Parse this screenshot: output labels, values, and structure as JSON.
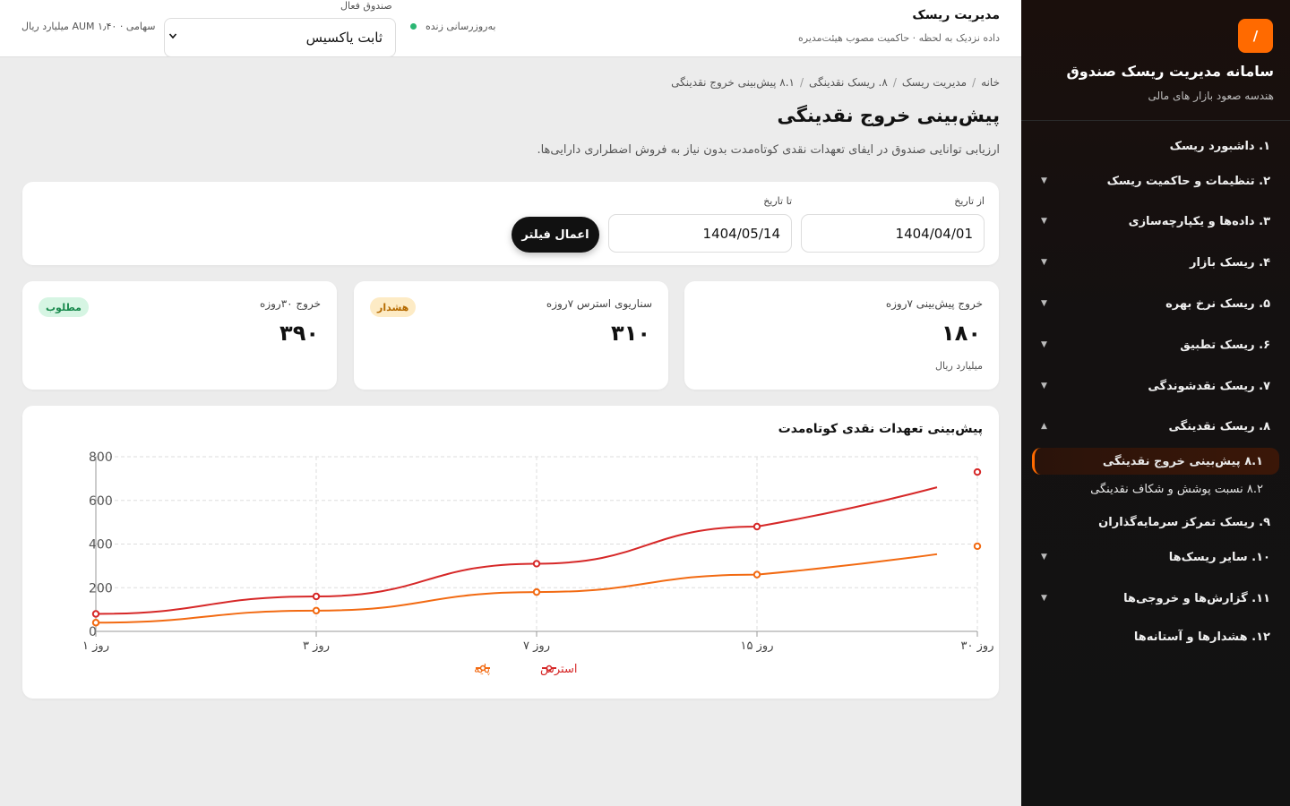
{
  "sidebar": {
    "logo": "/",
    "title": "سامانه مدیریت ریسک صندوق",
    "subtitle": "هندسه صعود بازار های مالی",
    "items": [
      {
        "label": "۱. داشبورد ریسک",
        "chevron": ""
      },
      {
        "label": "۲. تنظیمات و حاکمیت ریسک",
        "chevron": "▼"
      },
      {
        "label": "۳. داده‌ها و یکپارچه‌سازی",
        "chevron": "▼"
      },
      {
        "label": "۴. ریسک بازار",
        "chevron": "▼"
      },
      {
        "label": "۵. ریسک نرخ بهره",
        "chevron": "▼"
      },
      {
        "label": "۶. ریسک تطبیق",
        "chevron": "▼"
      },
      {
        "label": "۷. ریسک نقدشوندگی",
        "chevron": "▼"
      },
      {
        "label": "۸. ریسک نقدینگی",
        "chevron": "▲"
      },
      {
        "label": "۹. ریسک تمرکز سرمایه‌گذاران",
        "chevron": ""
      },
      {
        "label": "۱۰. سایر ریسک‌ها",
        "chevron": "▼"
      },
      {
        "label": "۱۱. گزارش‌ها و خروجی‌ها",
        "chevron": "▼"
      },
      {
        "label": "۱۲. هشدارها و آستانه‌ها",
        "chevron": ""
      }
    ],
    "subitems": [
      {
        "label": "۸.۱ پیش‌بینی خروج نقدینگی"
      },
      {
        "label": "۸.۲ نسبت پوشش و شکاف نقدینگی"
      }
    ]
  },
  "topbar": {
    "title": "مدیریت ریسک",
    "subtitle": "داده نزدیک به لحظه · حاکمیت مصوب هیئت‌مدیره",
    "live": "به‌روزرسانی زنده",
    "fund_label": "صندوق فعال",
    "fund_value": "ثابت یاکسیس",
    "aum": "سهامی · AUM ۱٫۴۰ میلیارد ریال"
  },
  "breadcrumb": [
    "خانه",
    "مدیریت ریسک",
    "۸. ریسک نقدینگی",
    "۸.۱ پیش‌بینی خروج نقدینگی"
  ],
  "page": {
    "title": "پیش‌بینی خروج نقدینگی",
    "desc": "ارزیابی توانایی صندوق در ایفای تعهدات نقدی کوتاه‌مدت بدون نیاز به فروش اضطراری دارایی‌ها."
  },
  "filter": {
    "from_label": "از تاریخ",
    "from_value": "1404/04/01",
    "to_label": "تا تاریخ",
    "to_value": "1404/05/14",
    "apply": "اعمال فیلتر"
  },
  "kpis": [
    {
      "label": "خروج پیش‌بینی ۷روزه",
      "value": "۱۸۰",
      "unit": "میلیارد ریال",
      "badge": ""
    },
    {
      "label": "سناریوی استرس ۷روزه",
      "value": "۳۱۰",
      "unit": "",
      "badge": "هشدار"
    },
    {
      "label": "خروج ۳۰روزه",
      "value": "۳۹۰",
      "unit": "",
      "badge": "مطلوب"
    }
  ],
  "colors": {
    "accent": "#ff6a00",
    "stress": "#d62828",
    "base": "#f26a12"
  },
  "chart_data": {
    "type": "line",
    "title": "پیش‌بینی تعهدات نقدی کوتاه‌مدت",
    "categories": [
      "روز ۱",
      "روز ۳",
      "روز ۷",
      "روز ۱۵",
      "روز ۳۰"
    ],
    "series": [
      {
        "name": "استرس",
        "values": [
          80,
          160,
          310,
          480,
          730
        ]
      },
      {
        "name": "پایه",
        "values": [
          40,
          95,
          180,
          260,
          390
        ]
      }
    ],
    "ylim": [
      0,
      800
    ],
    "yticks": [
      "0",
      "200",
      "400",
      "600",
      "800"
    ],
    "grid": true,
    "legend": "bottom-center"
  }
}
